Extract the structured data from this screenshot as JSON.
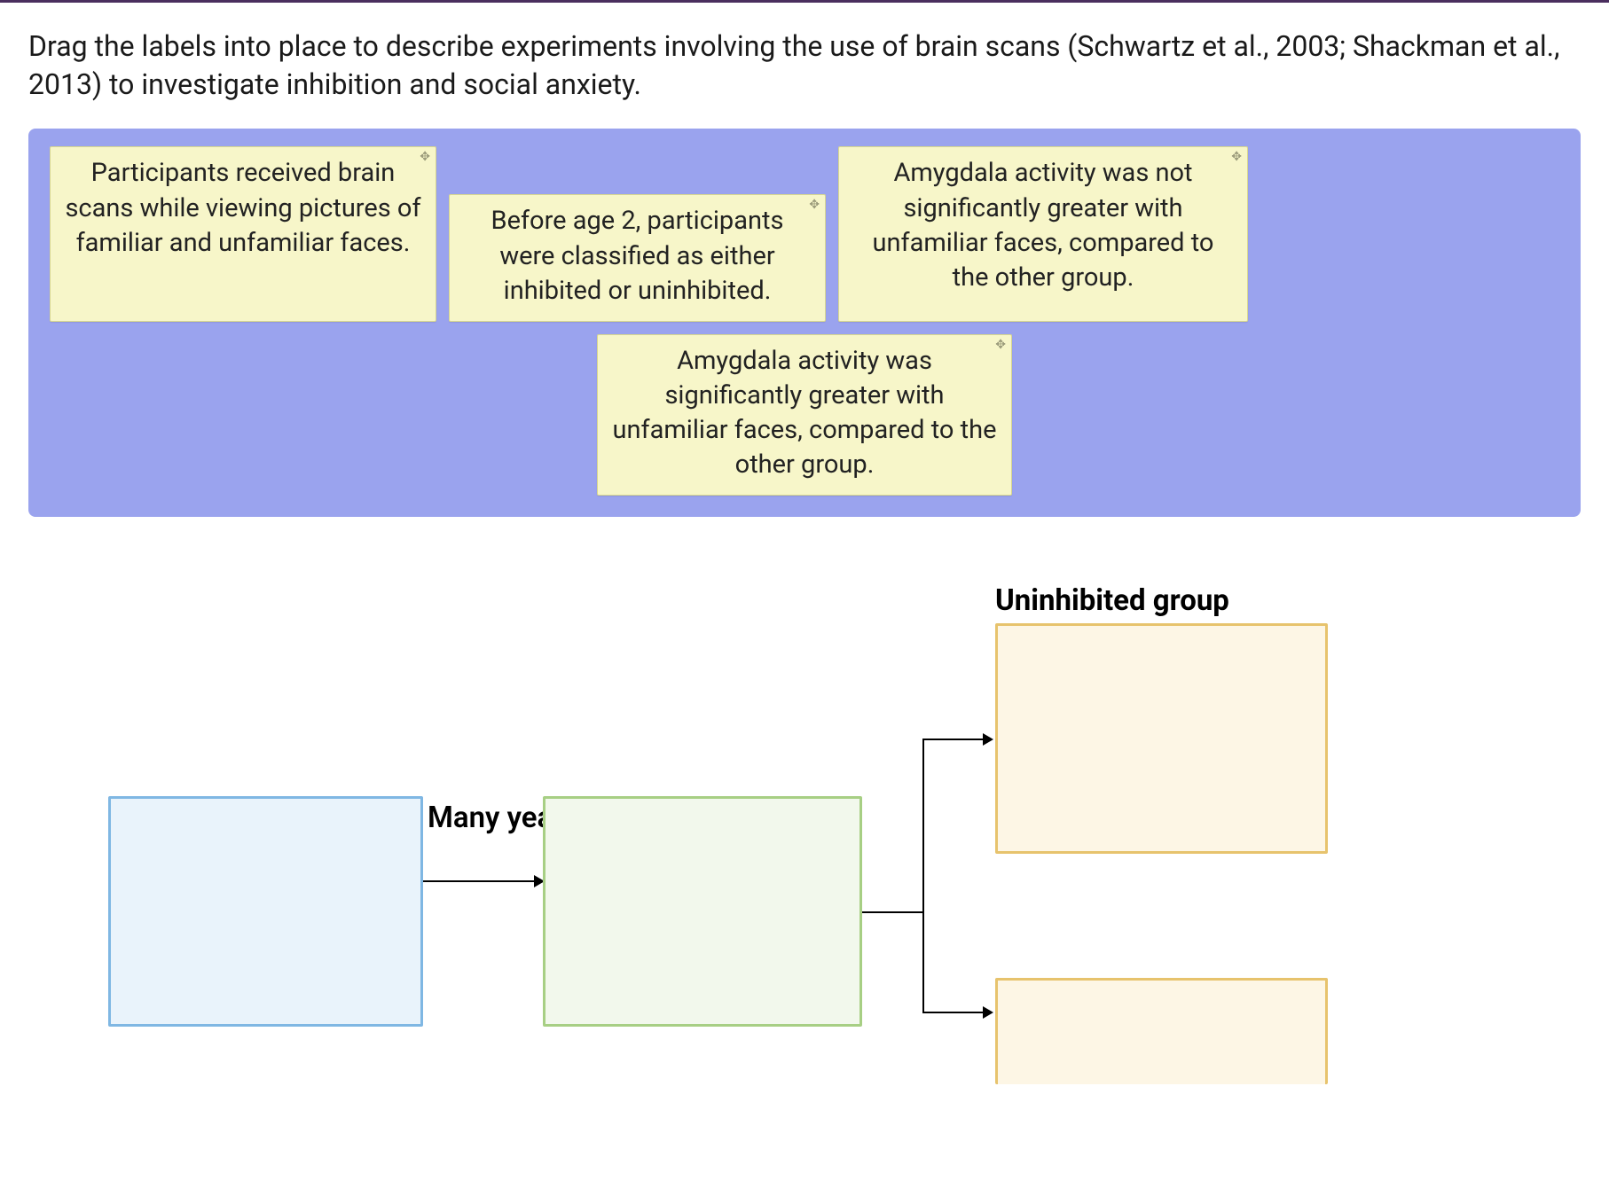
{
  "prompt": "Drag the labels into place to describe experiments involving the use of brain scans (Schwartz et al., 2003; Shackman et al., 2013) to investigate inhibition and social anxiety.",
  "labels": {
    "a": "Participants received brain scans while viewing pictures of familiar and unfamiliar faces.",
    "b": "Before age 2, participants were classified as either inhibited or uninhibited.",
    "c": "Amygdala activity was not significantly greater with unfamiliar faces, compared to the other group.",
    "d": "Amygdala activity was significantly greater with unfamiliar faces, compared to the other group."
  },
  "diagram": {
    "arrow1_label": "Many years",
    "uninhibited_label": "Uninhibited group"
  },
  "icons": {
    "move": "✥"
  }
}
